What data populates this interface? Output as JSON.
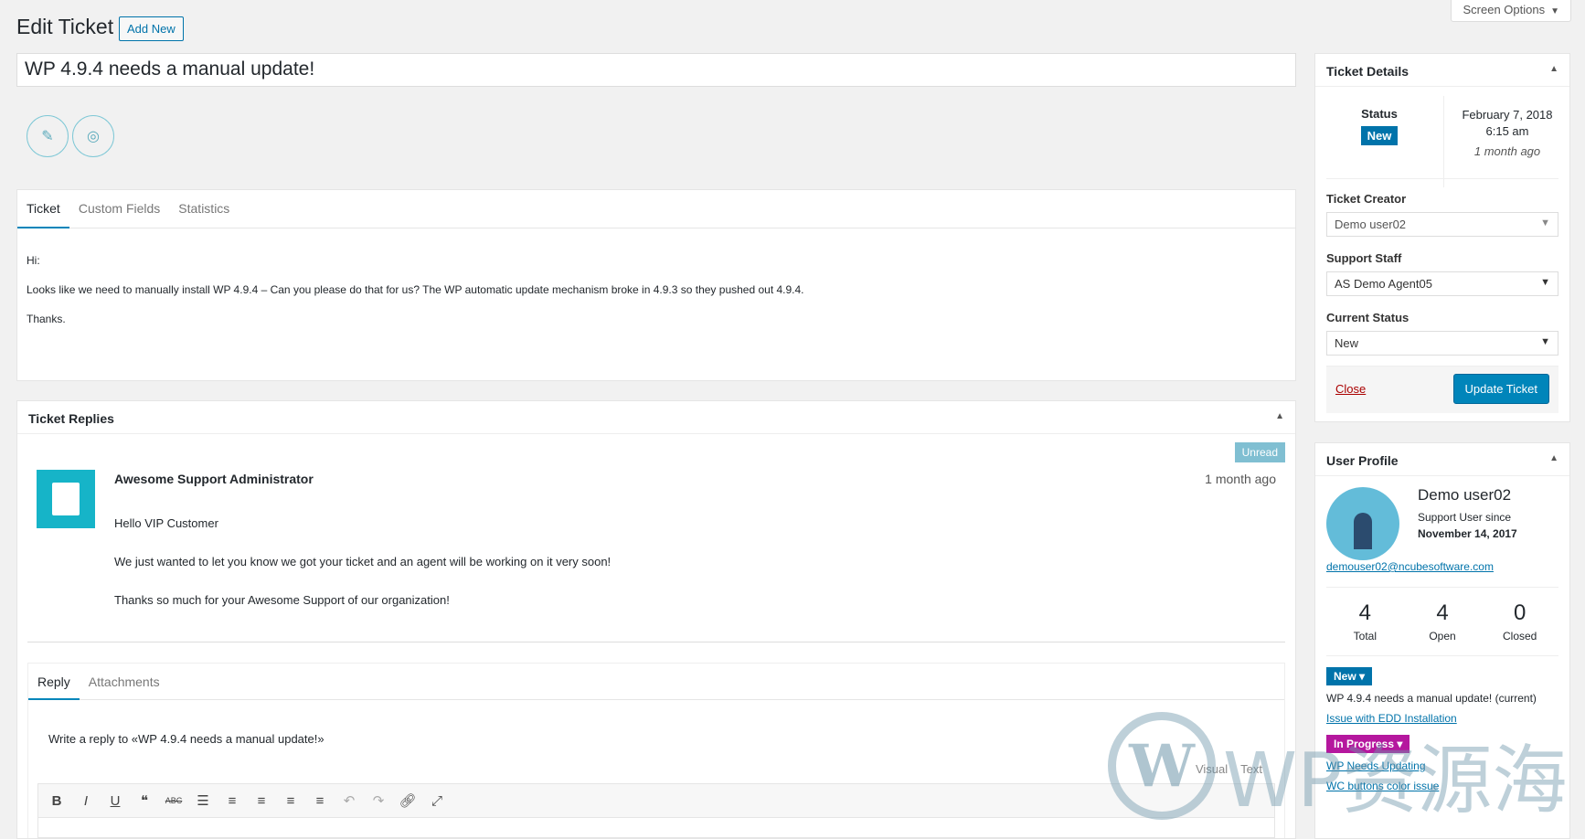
{
  "header": {
    "screen_options": "Screen Options",
    "page_title": "Edit Ticket",
    "add_new": "Add New",
    "ticket_title": "WP 4.9.4 needs a manual update!"
  },
  "ticket_tabs": [
    "Ticket",
    "Custom Fields",
    "Statistics"
  ],
  "ticket_body": [
    "Hi:",
    "Looks like we need to manually install WP 4.9.4 – Can you please do that for us?  The WP automatic update mechanism broke in 4.9.3 so they pushed out 4.9.4.",
    "Thanks."
  ],
  "replies": {
    "title": "Ticket Replies",
    "unread": "Unread",
    "author": "Awesome Support Administrator",
    "time": "1 month ago",
    "lines": [
      "Hello VIP Customer",
      "We just wanted to let you know we got your ticket and an agent will be working on it very soon!",
      "Thanks so much for your Awesome Support of our organization!"
    ],
    "editor_tabs": [
      "Reply",
      "Attachments"
    ],
    "write_prompt": "Write a reply to «WP 4.9.4 needs a manual update!»",
    "mode_visual": "Visual",
    "mode_text": "Text",
    "toolbar_icons": [
      "bold-icon",
      "italic-icon",
      "underline-icon",
      "blockquote-icon",
      "strikethrough-icon",
      "bullet-list-icon",
      "numbered-list-icon",
      "align-left-icon",
      "align-center-icon",
      "align-right-icon",
      "undo-icon",
      "redo-icon",
      "link-icon",
      "fullscreen-icon"
    ]
  },
  "ticket_details": {
    "title": "Ticket Details",
    "status_label": "Status",
    "status": "New",
    "date": "February 7, 2018",
    "time": "6:15 am",
    "ago": "1 month ago",
    "creator_label": "Ticket Creator",
    "creator": "Demo user02",
    "staff_label": "Support Staff",
    "staff": "AS Demo Agent05",
    "current_status_label": "Current Status",
    "current_status": "New",
    "close": "Close",
    "update": "Update Ticket"
  },
  "user_profile": {
    "title": "User Profile",
    "name": "Demo user02",
    "since_label": "Support User since",
    "since_date": "November 14, 2017",
    "email": "demouser02@ncubesoftware.com",
    "stats": [
      {
        "n": "4",
        "l": "Total"
      },
      {
        "n": "4",
        "l": "Open"
      },
      {
        "n": "0",
        "l": "Closed"
      }
    ],
    "new_pill": "New ▾",
    "current_ticket": "WP 4.9.4 needs a manual update! (current)",
    "link_edd": "Issue with EDD Installation",
    "progress_pill": "In Progress ▾",
    "link_wp": "WP Needs Updating",
    "link_wc": "WC buttons color issue"
  },
  "watermark": {
    "text": "WP资源海"
  },
  "colors": {
    "primary": "#0073aa",
    "button": "#0085ba",
    "in_progress": "#b5179e",
    "unread": "#80bfd2"
  }
}
